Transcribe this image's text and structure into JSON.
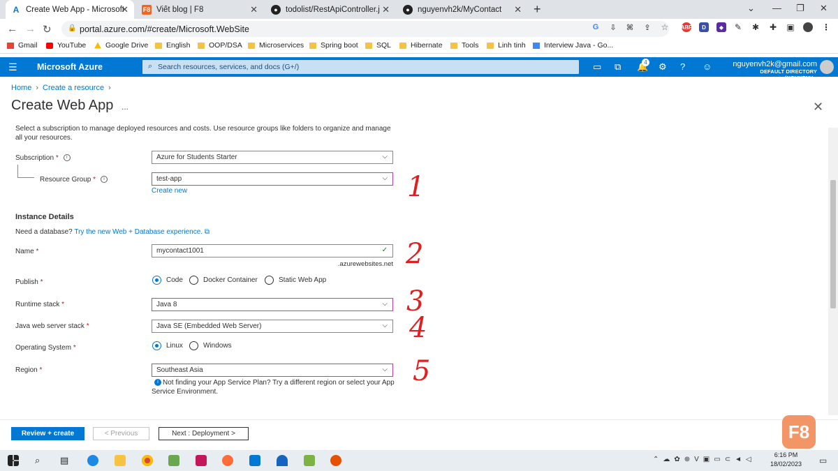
{
  "browser": {
    "tabs": [
      {
        "title": "Create Web App - Microsoft Azure",
        "icon": "azure-icon",
        "active": true
      },
      {
        "title": "Viết blog | F8",
        "icon": "f8-icon"
      },
      {
        "title": "todolist/RestApiController.java at",
        "icon": "github-icon"
      },
      {
        "title": "nguyenvh2k/MyContact",
        "icon": "github-icon"
      }
    ],
    "new_tab": "+",
    "url": "portal.azure.com/#create/Microsoft.WebSite",
    "bookmarks": [
      "Gmail",
      "YouTube",
      "Google Drive",
      "English",
      "OOP/DSA",
      "Microservices",
      "Spring boot",
      "SQL",
      "Hibernate",
      "Tools",
      "Linh tinh",
      "Interview Java - Go..."
    ]
  },
  "azure": {
    "brand": "Microsoft Azure",
    "search_placeholder": "Search resources, services, and docs (G+/)",
    "notification_count": "4",
    "account_email": "nguyenvh2k@gmail.com",
    "account_directory": "DEFAULT DIRECTORY (NGUYENV..."
  },
  "page": {
    "breadcrumb": [
      "Home",
      "Create a resource"
    ],
    "title": "Create Web App",
    "more": "...",
    "intro": "Select a subscription to manage deployed resources and costs. Use resource groups like folders to organize and manage all your resources.",
    "subscription": {
      "label": "Subscription",
      "value": "Azure for Students Starter"
    },
    "resource_group": {
      "label": "Resource Group",
      "value": "test-app",
      "create_new": "Create new"
    },
    "instance_details": "Instance Details",
    "need_db": "Need a database?",
    "try_link": "Try the new Web + Database experience.",
    "name": {
      "label": "Name",
      "value": "mycontact1001",
      "suffix": ".azurewebsites.net"
    },
    "publish": {
      "label": "Publish",
      "options": [
        "Code",
        "Docker Container",
        "Static Web App"
      ],
      "selected": "Code"
    },
    "runtime": {
      "label": "Runtime stack",
      "value": "Java 8"
    },
    "java_server": {
      "label": "Java web server stack",
      "value": "Java SE (Embedded Web Server)"
    },
    "os": {
      "label": "Operating System",
      "options": [
        "Linux",
        "Windows"
      ],
      "selected": "Linux"
    },
    "region": {
      "label": "Region",
      "value": "Southeast Asia",
      "note": "Not finding your App Service Plan? Try a different region or select your App Service Environment."
    },
    "annotations": [
      "1",
      "2",
      "3",
      "4",
      "5"
    ]
  },
  "footer": {
    "review": "Review + create",
    "previous": "< Previous",
    "next": "Next : Deployment >",
    "logo": "F8"
  },
  "taskbar": {
    "time": "6:16 PM",
    "date": "18/02/2023"
  },
  "colors": {
    "azure_blue": "#0078d4",
    "annotation_red": "#e02020",
    "focus_border": "#c239b3"
  }
}
